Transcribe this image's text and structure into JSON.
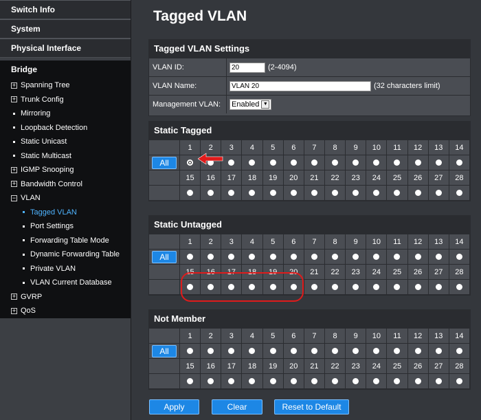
{
  "sidebar": {
    "top_items": [
      "Switch Info",
      "System",
      "Physical Interface"
    ],
    "bridge_title": "Bridge",
    "bridge_items": [
      {
        "label": "Spanning Tree",
        "marker": "+"
      },
      {
        "label": "Trunk Config",
        "marker": "+"
      },
      {
        "label": "Mirroring",
        "marker": "dot"
      },
      {
        "label": "Loopback Detection",
        "marker": "dot"
      },
      {
        "label": "Static Unicast",
        "marker": "dot"
      },
      {
        "label": "Static Multicast",
        "marker": "dot"
      },
      {
        "label": "IGMP Snooping",
        "marker": "+"
      },
      {
        "label": "Bandwidth Control",
        "marker": "+"
      },
      {
        "label": "VLAN",
        "marker": "−"
      }
    ],
    "vlan_items": [
      "Tagged VLAN",
      "Port Settings",
      "Forwarding Table Mode",
      "Dynamic Forwarding Table",
      "Private VLAN",
      "VLAN Current Database"
    ],
    "after_items": [
      {
        "label": "GVRP",
        "marker": "+"
      },
      {
        "label": "QoS",
        "marker": "+"
      }
    ],
    "active_item": "Tagged VLAN",
    "active_color": "#4fb4ff"
  },
  "page_title": "Tagged VLAN",
  "settings": {
    "header": "Tagged VLAN Settings",
    "vlan_id_label": "VLAN ID:",
    "vlan_id_value": "20",
    "vlan_id_hint": "(2-4094)",
    "vlan_name_label": "VLAN Name:",
    "vlan_name_value": "VLAN 20",
    "vlan_name_hint": "(32 characters limit)",
    "mgmt_label": "Management VLAN:",
    "mgmt_value": "Enabled"
  },
  "groups": [
    {
      "header": "Static Tagged",
      "all_label": "All",
      "checked_ports": [
        1
      ]
    },
    {
      "header": "Static Untagged",
      "all_label": "All",
      "checked_ports": []
    },
    {
      "header": "Not Member",
      "all_label": "All",
      "checked_ports": []
    }
  ],
  "ports_row1": [
    "1",
    "2",
    "3",
    "4",
    "5",
    "6",
    "7",
    "8",
    "9",
    "10",
    "11",
    "12",
    "13",
    "14"
  ],
  "ports_row2": [
    "15",
    "16",
    "17",
    "18",
    "19",
    "20",
    "21",
    "22",
    "23",
    "24",
    "25",
    "26",
    "27",
    "28"
  ],
  "buttons": {
    "apply": "Apply",
    "clear": "Clear",
    "reset": "Reset to Default"
  },
  "annotation_color": "#e01b1b"
}
